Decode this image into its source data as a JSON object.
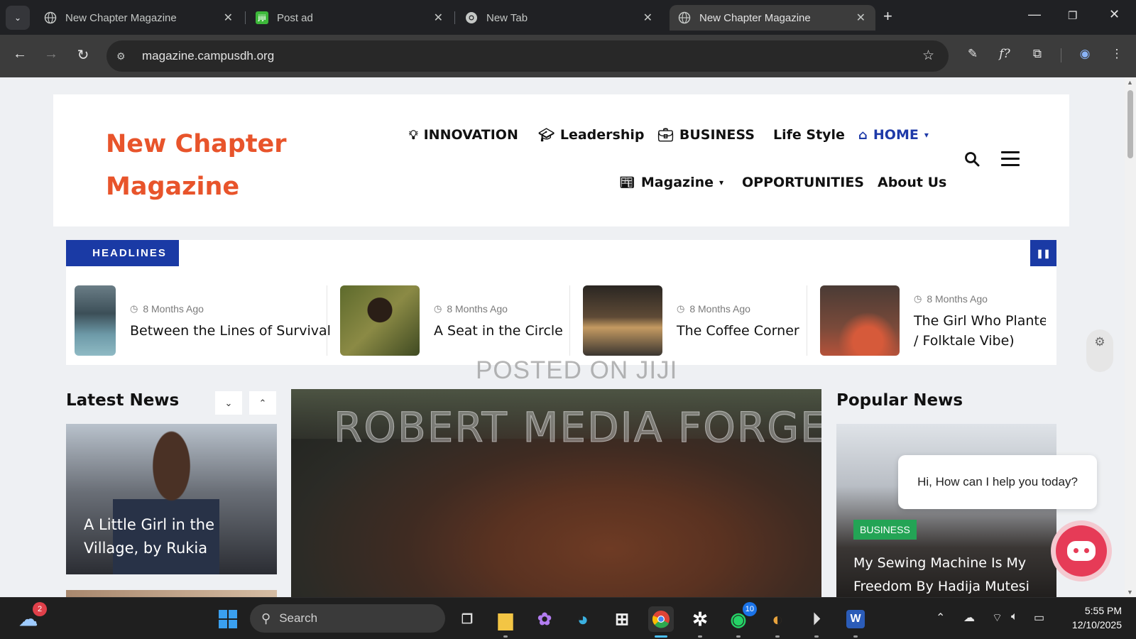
{
  "browser": {
    "tabs": [
      {
        "title": "New Chapter Magazine",
        "active": false
      },
      {
        "title": "Post ad",
        "active": false
      },
      {
        "title": "New Tab",
        "active": false
      },
      {
        "title": "New Chapter Magazine",
        "active": true
      }
    ],
    "url": "magazine.campusdh.org",
    "accent": "#3c3c3c"
  },
  "site": {
    "logo_line1": "New Chapter",
    "logo_line2": "Magazine",
    "brand_color": "#e8542b",
    "nav_row1": [
      {
        "label": "INNOVATION",
        "icon": "lightbulb-icon"
      },
      {
        "label": "Leadership",
        "icon": "graduation-cap-icon"
      },
      {
        "label": "BUSINESS",
        "icon": "briefcase-icon"
      },
      {
        "label": "Life Style",
        "icon": ""
      },
      {
        "label": "HOME",
        "icon": "home-wifi-icon",
        "dropdown": true
      }
    ],
    "nav_row2": [
      {
        "label": "Magazine",
        "icon": "newspaper-icon",
        "dropdown": true
      },
      {
        "label": "OPPORTUNITIES",
        "icon": ""
      },
      {
        "label": "About Us",
        "icon": ""
      }
    ],
    "home_color": "#1e3aa8"
  },
  "headlines": {
    "badge": "HEADLINES",
    "badge_color": "#1a3aa5",
    "items": [
      {
        "time": "8 Months Ago",
        "title": "Between the Lines of Survival"
      },
      {
        "time": "8 Months Ago",
        "title": "A Seat in the Circle"
      },
      {
        "time": "8 Months Ago",
        "title": "The Coffee Corner"
      },
      {
        "time": "8 Months Ago",
        "title": "The Girl Who Plante",
        "title_line2": "/ Folktale Vibe)"
      }
    ]
  },
  "watermarks": {
    "small": "POSTED ON JIJI",
    "large": "ROBERT MEDIA FORGE"
  },
  "latest": {
    "heading": "Latest News",
    "card_caption": "A Little Girl in the Village, by Rukia"
  },
  "popular": {
    "heading": "Popular News",
    "badge": "BUSINESS",
    "badge_color": "#23a455",
    "card_caption": "My Sewing Machine Is My Freedom By Hadija Mutesi"
  },
  "chat": {
    "greeting": "Hi, How can I help you today?",
    "color": "#e63b57"
  },
  "taskbar": {
    "weather_badge": "2",
    "search_placeholder": "Search",
    "whatsapp_badge": "10",
    "time": "5:55 PM",
    "date": "12/10/2025"
  }
}
